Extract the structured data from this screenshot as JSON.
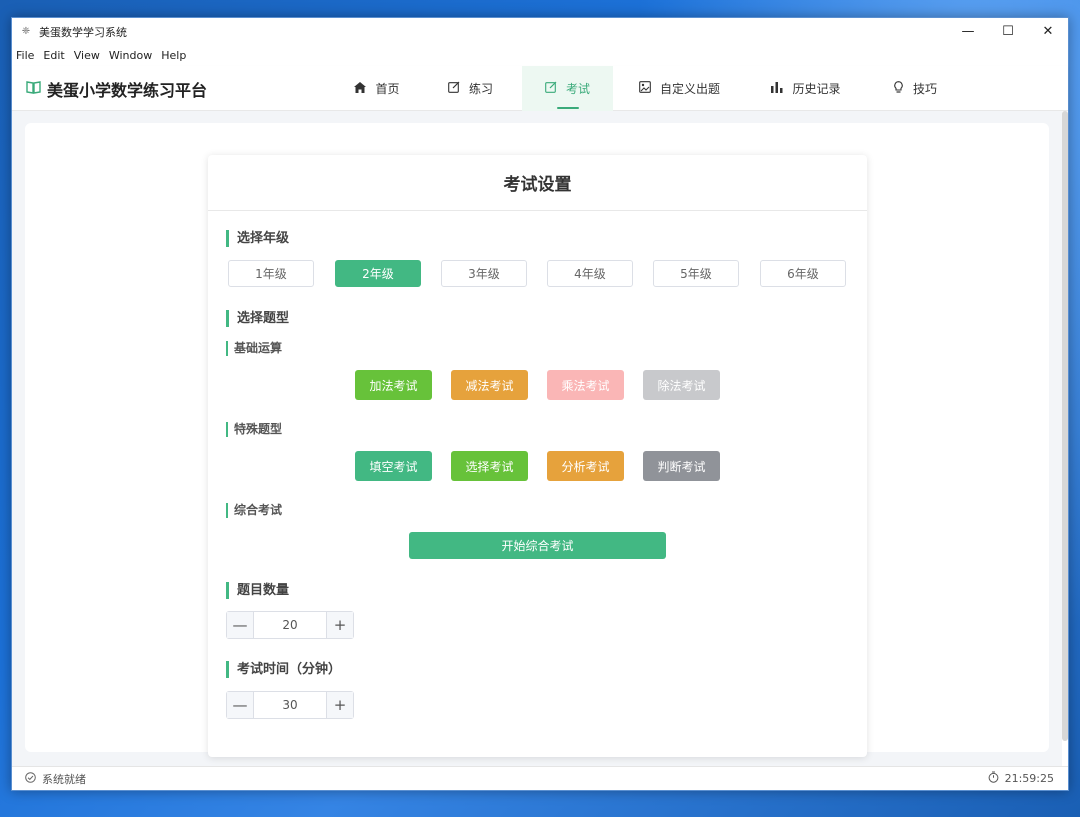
{
  "window": {
    "title": "美蛋数学学习系统",
    "controls": {
      "minimize": "—",
      "maximize": "☐",
      "close": "✕"
    }
  },
  "menu": [
    "File",
    "Edit",
    "View",
    "Window",
    "Help"
  ],
  "brand": {
    "icon": "book-icon",
    "name": "美蛋小学数学练习平台"
  },
  "nav": [
    {
      "label": "首页",
      "icon": "home-icon",
      "glyph": "⌂"
    },
    {
      "label": "练习",
      "icon": "edit-icon",
      "glyph": "✎"
    },
    {
      "label": "考试",
      "icon": "edit-icon",
      "glyph": "✎",
      "active": true
    },
    {
      "label": "自定义出题",
      "icon": "picture-icon",
      "glyph": "▣"
    },
    {
      "label": "历史记录",
      "icon": "chart-icon",
      "glyph": "▮"
    },
    {
      "label": "技巧",
      "icon": "lightbulb-icon",
      "glyph": "♀"
    }
  ],
  "card": {
    "title": "考试设置",
    "grade_section": "选择年级",
    "grades": [
      "1年级",
      "2年级",
      "3年级",
      "4年级",
      "5年级",
      "6年级"
    ],
    "selected_grade": "2年级",
    "type_section": "选择题型",
    "basic_title": "基础运算",
    "basic_buttons": [
      {
        "label": "加法考试",
        "color": "#67c23a"
      },
      {
        "label": "减法考试",
        "color": "#e6a23c"
      },
      {
        "label": "乘法考试",
        "color": "#fab6b6"
      },
      {
        "label": "除法考试",
        "color": "#c8c9cc"
      }
    ],
    "special_title": "特殊题型",
    "special_buttons": [
      {
        "label": "填空考试",
        "color": "#42b883"
      },
      {
        "label": "选择考试",
        "color": "#67c23a"
      },
      {
        "label": "分析考试",
        "color": "#e6a23c"
      },
      {
        "label": "判断考试",
        "color": "#909399"
      }
    ],
    "comprehensive_title": "综合考试",
    "comprehensive_button": "开始综合考试",
    "count_title": "题目数量",
    "count_value": "20",
    "time_title": "考试时间（分钟）",
    "time_value": "30",
    "stepper": {
      "minus": "—",
      "plus": "+"
    }
  },
  "status": {
    "text": "系统就绪",
    "left_icon": "check-circle-icon",
    "right_icon": "timer-icon",
    "time": "21:59:25"
  },
  "colors": {
    "accent": "#42b883"
  }
}
